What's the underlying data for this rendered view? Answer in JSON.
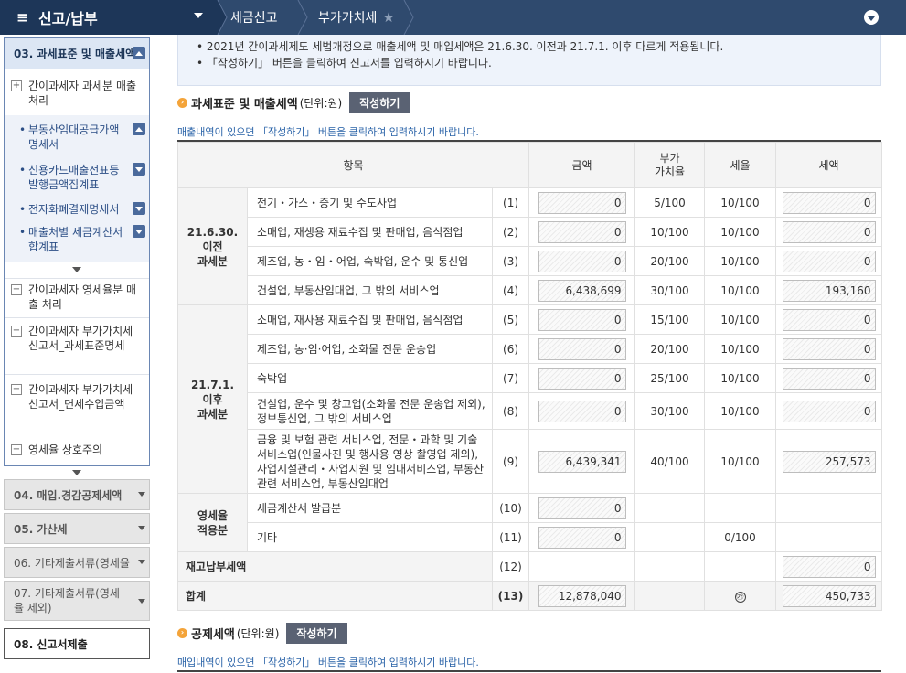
{
  "topbar": {
    "menu_icon": "≡",
    "menu_title": "신고/납부",
    "crumbs": [
      "세금신고",
      "부가가치세"
    ],
    "star_icon": "★"
  },
  "sidebar": {
    "active_header": "03. 과세표준 및 매출세액",
    "group1": "간이과세자 과세분 매출 처리",
    "subitems": [
      "부동산임대공급가액명세서",
      "신용카드매출전표등발행금액집계표",
      "전자화폐결제명세서",
      "매출처별 세금계산서합계표"
    ],
    "group2": "간이과세자 영세율분 매출 처리",
    "group3": "간이과세자 부가가치세 신고서_과세표준명세",
    "group4": "간이과세자 부가가치세 신고서_면세수입금액",
    "group5": "영세율 상호주의",
    "steps": [
      "04. 매입.경감공제세액",
      "05. 가산세",
      "06. 기타제출서류(영세율",
      "07. 기타제출서류(영세율 제외)",
      "08. 신고서제출"
    ]
  },
  "notice": {
    "line1": "2021년 간이과세제도 세법개정으로 매출세액 및 매입세액은 21.6.30. 이전과 21.7.1. 이후 다르게 적용됩니다.",
    "line2": "「작성하기」 버튼을 클릭하여 신고서를 입력하시기 바랍니다."
  },
  "section1": {
    "title": "과세표준 및 매출세액",
    "unit": "(단위:원)",
    "button": "작성하기",
    "hint": "매출내역이 있으면 「작성하기」 버튼을 클릭하여 입력하시기 바랍니다."
  },
  "table": {
    "headers": {
      "item": "항목",
      "amount": "금액",
      "value_rate": "부가\n가치율",
      "tax_rate": "세율",
      "tax": "세액"
    },
    "groups": {
      "before": "21.6.30.\n이전\n과세분",
      "after": "21.7.1.\n이후\n과세분",
      "zero": "영세율\n적용분"
    },
    "rows": [
      {
        "item": "전기・가스・증기 및 수도사업",
        "no": "(1)",
        "amount": "0",
        "vr": "5/100",
        "tr": "10/100",
        "tax": "0"
      },
      {
        "item": "소매업, 재생용 재료수집 및 판매업, 음식점업",
        "no": "(2)",
        "amount": "0",
        "vr": "10/100",
        "tr": "10/100",
        "tax": "0"
      },
      {
        "item": "제조업, 농・임・어업, 숙박업, 운수 및 통신업",
        "no": "(3)",
        "amount": "0",
        "vr": "20/100",
        "tr": "10/100",
        "tax": "0"
      },
      {
        "item": "건설업, 부동산임대업, 그 밖의 서비스업",
        "no": "(4)",
        "amount": "6,438,699",
        "vr": "30/100",
        "tr": "10/100",
        "tax": "193,160"
      },
      {
        "item": "소매업, 재사용 재료수집 및 판매업, 음식점업",
        "no": "(5)",
        "amount": "0",
        "vr": "15/100",
        "tr": "10/100",
        "tax": "0"
      },
      {
        "item": "제조업, 농·임·어업, 소화물 전문 운송업",
        "no": "(6)",
        "amount": "0",
        "vr": "20/100",
        "tr": "10/100",
        "tax": "0"
      },
      {
        "item": "숙박업",
        "no": "(7)",
        "amount": "0",
        "vr": "25/100",
        "tr": "10/100",
        "tax": "0"
      },
      {
        "item": "건설업, 운수 및 창고업(소화물 전문 운송업 제외), 정보통신업, 그 밖의 서비스업",
        "no": "(8)",
        "amount": "0",
        "vr": "30/100",
        "tr": "10/100",
        "tax": "0"
      },
      {
        "item": "금융 및 보험 관련 서비스업, 전문・과학 및 기술서비스업(인물사진 및 행사용 영상 촬영업 제외), 사업시설관리・사업지원 및 임대서비스업, 부동산 관련 서비스업, 부동산임대업",
        "no": "(9)",
        "amount": "6,439,341",
        "vr": "40/100",
        "tr": "10/100",
        "tax": "257,573"
      },
      {
        "item": "세금계산서 발급분",
        "no": "(10)",
        "amount": "0",
        "vr": "",
        "tr": "",
        "tax": ""
      },
      {
        "item": "기타",
        "no": "(11)",
        "amount": "0",
        "vr": "",
        "tr": "0/100",
        "tax": ""
      }
    ],
    "reserve": {
      "label": "재고납부세액",
      "no": "(12)",
      "tax": "0"
    },
    "total": {
      "label": "합계",
      "no": "(13)",
      "amount": "12,878,040",
      "mark": "㉮",
      "tax": "450,733"
    }
  },
  "section2": {
    "title": "공제세액",
    "unit": "(단위:원)",
    "button": "작성하기",
    "hint": "매입내역이 있으면 「작성하기」 버튼을 클릭하여 입력하시기 바랍니다."
  }
}
